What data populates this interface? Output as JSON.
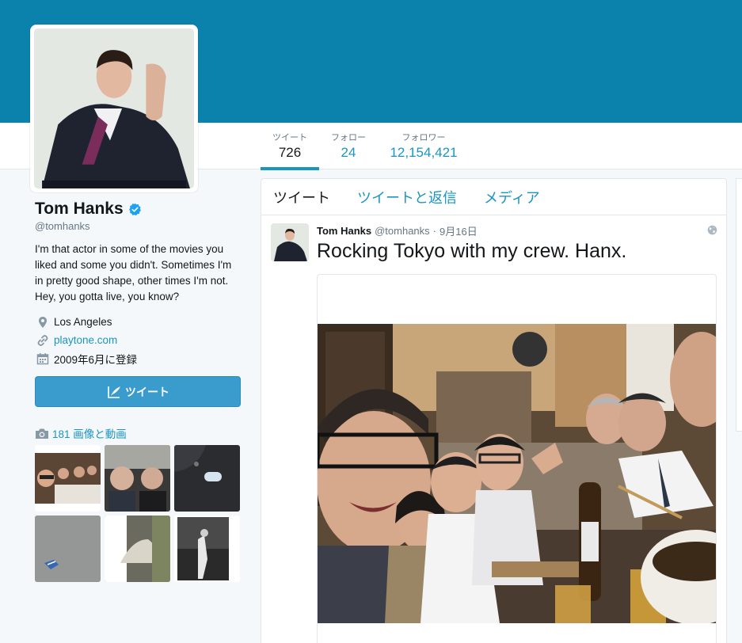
{
  "profile": {
    "name": "Tom Hanks",
    "handle": "@tomhanks",
    "bio": "I'm that actor in some of the movies you liked and some you didn't. Sometimes I'm in pretty good shape, other times I'm not. Hey, you gotta live, you know?",
    "location": "Los Angeles",
    "website": "playtone.com",
    "joined": "2009年6月に登録",
    "tweet_button": "ツイート",
    "media_link": "181 画像と動画"
  },
  "stats": [
    {
      "label": "ツイート",
      "value": "726"
    },
    {
      "label": "フォロー",
      "value": "24"
    },
    {
      "label": "フォロワー",
      "value": "12,154,421"
    }
  ],
  "tabs": [
    "ツイート",
    "ツイートと返信",
    "メディア"
  ],
  "tweet": {
    "name": "Tom Hanks",
    "handle": "@tomhanks",
    "time": "9月16日",
    "text": "Rocking Tokyo with my crew. Hanx."
  },
  "colors": {
    "banner": "#0a82ac",
    "accent": "#1b95c0",
    "button": "#3a9ccc"
  },
  "icons": [
    "verified-badge-icon",
    "location-pin-icon",
    "link-icon",
    "calendar-icon",
    "feather-icon",
    "camera-icon",
    "globe-icon"
  ]
}
